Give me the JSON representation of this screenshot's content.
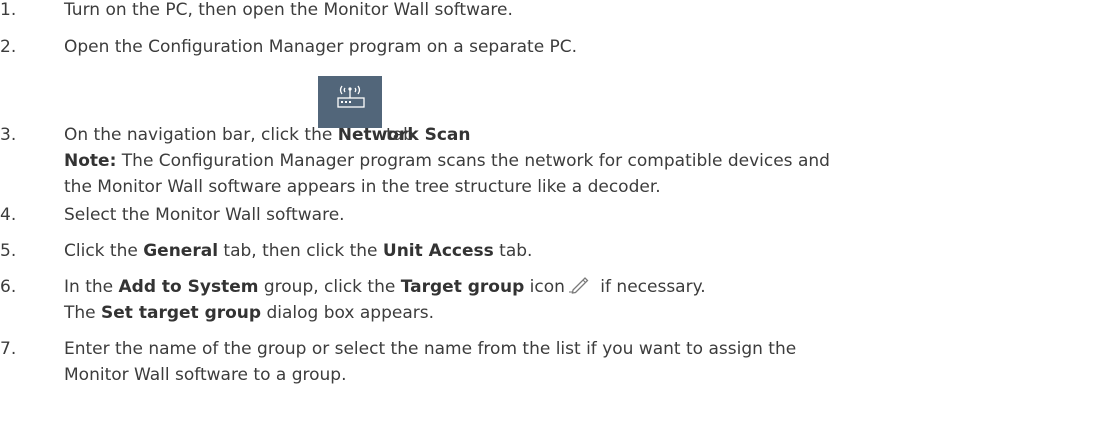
{
  "steps": [
    {
      "num": "1.",
      "text": "Turn on the PC, then open the Monitor Wall software."
    },
    {
      "num": "2.",
      "text": "Open the Configuration Manager program on a separate PC."
    },
    {
      "num": "3.",
      "pre": "On the navigation bar, click the ",
      "bold": "Network Scan",
      "post": " tab.",
      "icon": "network-scan-icon",
      "note_label": "Note:",
      "note_line1": " The Configuration Manager program scans the network for compatible devices and",
      "note_line2": "the Monitor Wall software appears in the tree structure like a decoder."
    },
    {
      "num": "4.",
      "text": "Select the Monitor Wall software."
    },
    {
      "num": "5.",
      "pre": "Click the ",
      "bold1": "General",
      "mid": " tab, then click the ",
      "bold2": "Unit Access",
      "post": " tab."
    },
    {
      "num": "6.",
      "pre": "In the ",
      "bold1": "Add to System",
      "mid": " group, click the ",
      "bold2": "Target group",
      "mid2": " icon",
      "post": " if necessary.",
      "icon": "pencil-icon",
      "line2_bold": "Set target group",
      "line2_post": " dialog box appears.",
      "line2_pre": "The "
    },
    {
      "num": "7.",
      "text": "Enter the name of the group or select the name from the list if you want to assign the",
      "text_line2": "Monitor Wall software to a group."
    }
  ],
  "colors": {
    "text": "#3c3c3c",
    "icon_bg": "#52667a"
  }
}
